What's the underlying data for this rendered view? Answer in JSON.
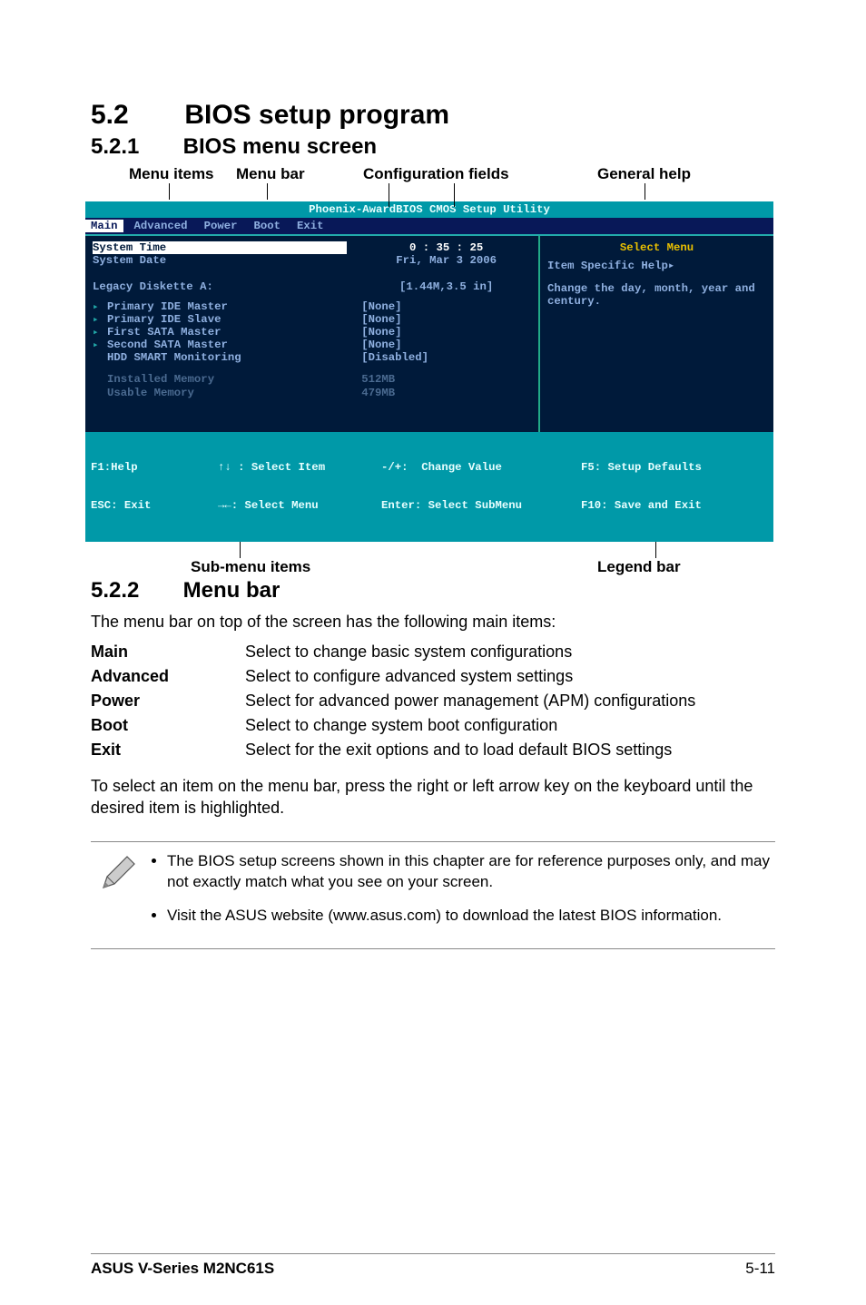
{
  "heading": {
    "number": "5.2",
    "title": "BIOS setup program"
  },
  "sub521": {
    "number": "5.2.1",
    "title": "BIOS menu screen"
  },
  "sub522": {
    "number": "5.2.2",
    "title": "Menu bar"
  },
  "annotations": {
    "menu_items": "Menu items",
    "menu_bar": "Menu bar",
    "config_fields": "Configuration fields",
    "general_help": "General help",
    "sub_menu": "Sub-menu items",
    "legend_bar": "Legend bar"
  },
  "bios": {
    "title": "Phoenix-AwardBIOS CMOS Setup Utility",
    "tabs": {
      "main": "Main",
      "advanced": "Advanced",
      "power": "Power",
      "boot": "Boot",
      "exit": "Exit"
    },
    "left": {
      "system_time": "System Time",
      "system_date": "System Date",
      "legacy": "Legacy Diskette A:",
      "pri_master": "Primary IDE Master",
      "pri_slave": "Primary IDE Slave",
      "first_sata": "First SATA Master",
      "second_sata": "Second SATA Master",
      "hdd_smart": "HDD SMART Monitoring",
      "installed_mem": "Installed Memory",
      "usable_mem": "Usable Memory"
    },
    "mid": {
      "time": "0 : 35 : 25",
      "date": "Fri, Mar 3 2006",
      "legacy": "[1.44M,3.5 in]",
      "pri_master": "[None]",
      "pri_slave": "[None]",
      "first_sata": "[None]",
      "second_sata": "[None]",
      "hdd_smart": "[Disabled]",
      "installed_mem": "512MB",
      "usable_mem": "479MB"
    },
    "right": {
      "select_menu": "Select Menu",
      "specific_help": "Item Specific Help▸",
      "help_text": "Change the day, month, year and century."
    },
    "legend": {
      "f1": "F1:Help",
      "esc": "ESC: Exit",
      "sel_item": "↑↓ : Select Item",
      "sel_menu": "→←: Select Menu",
      "change_val": "-/+:  Change Value",
      "enter": "Enter: Select SubMenu",
      "f5": "F5: Setup Defaults",
      "f10": "F10: Save and Exit"
    }
  },
  "para_intro": "The menu bar on top of the screen has the following main items:",
  "defs": {
    "main": {
      "term": "Main",
      "desc": "Select to change basic system configurations"
    },
    "advanced": {
      "term": "Advanced",
      "desc": "Select to configure advanced system settings"
    },
    "power": {
      "term": "Power",
      "desc": "Select for advanced power management (APM) configurations"
    },
    "boot": {
      "term": "Boot",
      "desc": "Select to change system boot configuration"
    },
    "exit": {
      "term": "Exit",
      "desc": "Select for the exit options and to load default BIOS settings"
    }
  },
  "para_select": "To select an item on the menu bar, press the right or left arrow key on the keyboard until the desired item is highlighted.",
  "notes": {
    "n1": "The BIOS setup screens shown in this chapter are for reference purposes only, and may not exactly match what you see on your screen.",
    "n2": "Visit the ASUS website (www.asus.com) to download the latest BIOS information."
  },
  "footer": {
    "product": "ASUS V-Series M2NC61S",
    "page": "5-11"
  },
  "chart_data": null
}
